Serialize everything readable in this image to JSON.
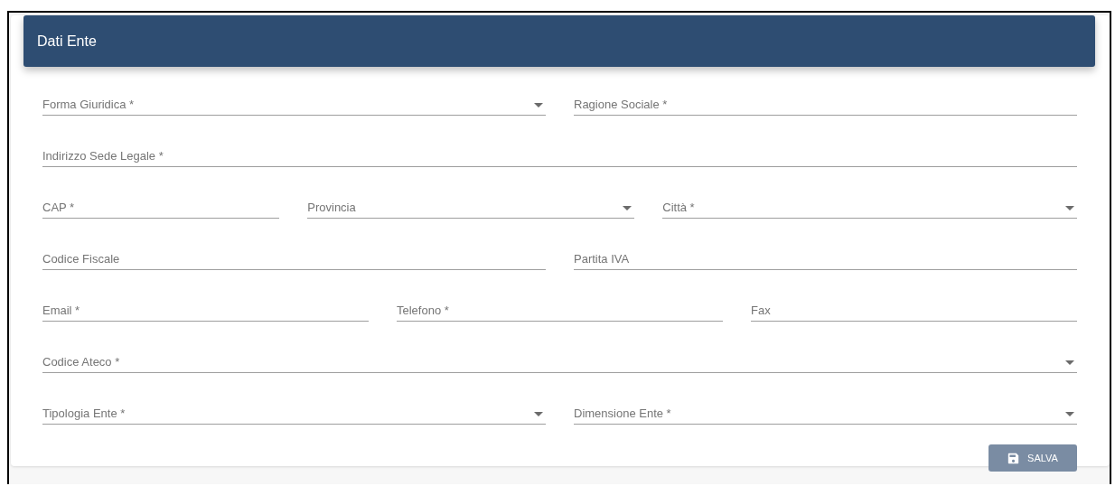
{
  "header": {
    "title": "Dati Ente"
  },
  "rows": [
    {
      "fields": [
        {
          "placeholder": "Forma Giuridica *",
          "kind": "select"
        },
        {
          "placeholder": "Ragione Sociale *",
          "kind": "text"
        }
      ]
    },
    {
      "fields": [
        {
          "placeholder": "Indirizzo Sede Legale *",
          "kind": "text"
        }
      ]
    },
    {
      "fields": [
        {
          "placeholder": "CAP *",
          "kind": "text"
        },
        {
          "placeholder": "Provincia",
          "kind": "select"
        },
        {
          "placeholder": "Città *",
          "kind": "select"
        }
      ]
    },
    {
      "fields": [
        {
          "placeholder": "Codice Fiscale",
          "kind": "text"
        },
        {
          "placeholder": "Partita IVA",
          "kind": "text"
        }
      ]
    },
    {
      "fields": [
        {
          "placeholder": "Email *",
          "kind": "text"
        },
        {
          "placeholder": "Telefono *",
          "kind": "text"
        },
        {
          "placeholder": "Fax",
          "kind": "text"
        }
      ]
    },
    {
      "fields": [
        {
          "placeholder": "Codice Ateco *",
          "kind": "select"
        }
      ]
    },
    {
      "fields": [
        {
          "placeholder": "Tipologia Ente *",
          "kind": "select"
        },
        {
          "placeholder": "Dimensione Ente *",
          "kind": "select"
        }
      ]
    }
  ],
  "save_button": {
    "label": "SALVA",
    "disabled": true
  }
}
